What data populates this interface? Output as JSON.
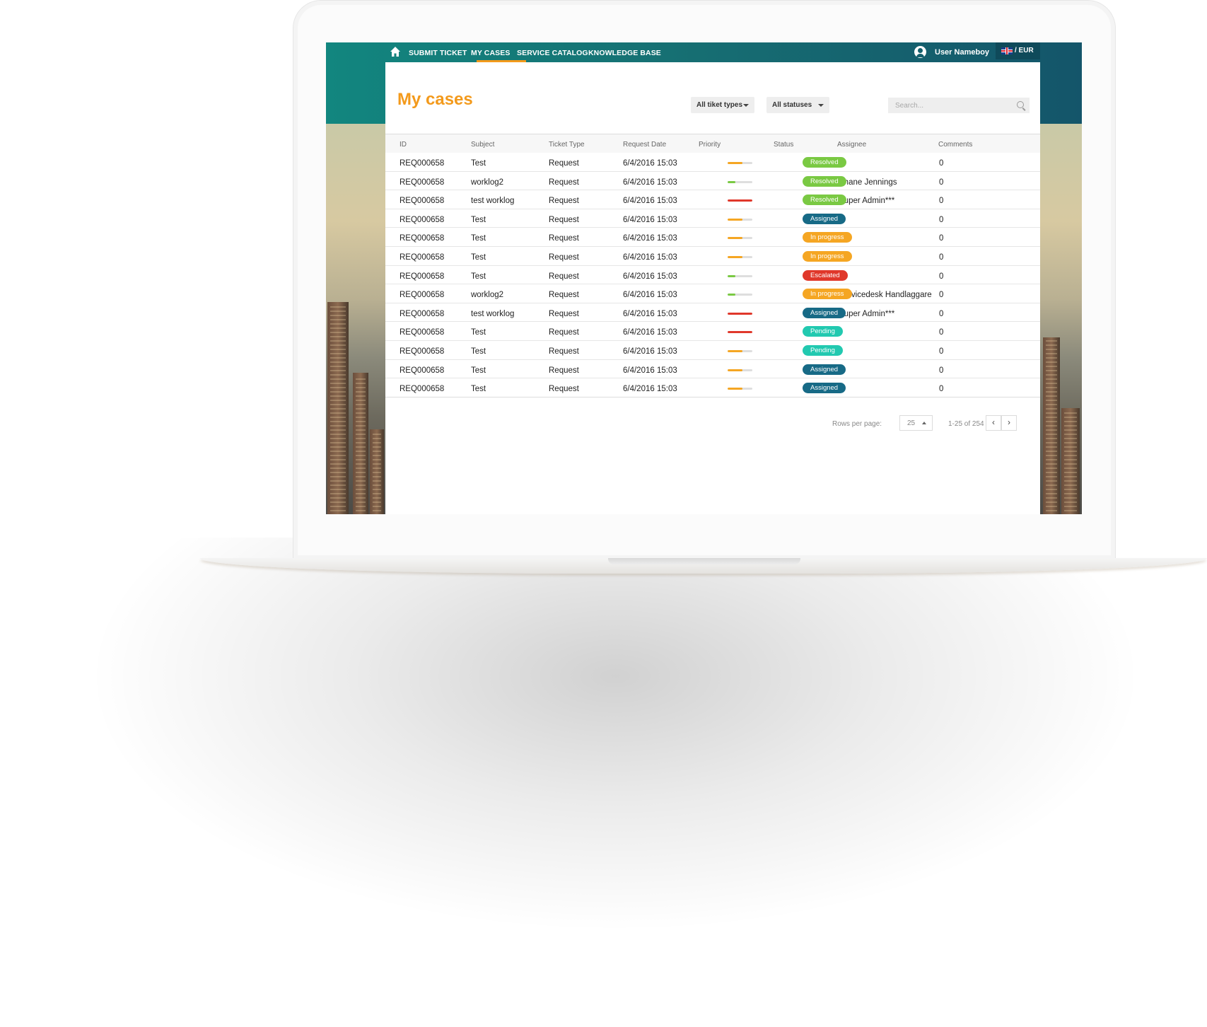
{
  "nav": {
    "items": [
      {
        "label": "SUBMIT TICKET"
      },
      {
        "label": "MY CASES"
      },
      {
        "label": "SERVICE CATALOG"
      },
      {
        "label": "KNOWLEDGE BASE"
      }
    ],
    "user": "User Nameboy",
    "locale": "/ EUR",
    "icons": [
      "home-icon",
      "user-icon",
      "uk-flag-icon"
    ]
  },
  "page": {
    "title": "My cases",
    "filter_type": "All tiket types",
    "filter_status": "All statuses",
    "search_placeholder": "Search..."
  },
  "table": {
    "headers": [
      "ID",
      "Subject",
      "Ticket Type",
      "Request Date",
      "Priority",
      "Status",
      "Assignee",
      "Comments"
    ],
    "rows": [
      {
        "id": "REQ000658",
        "subject": "Test",
        "type": "Request",
        "date": "6/4/2016 15:03",
        "priority": 0.6,
        "priority_color": "#f5a623",
        "status": "Resolved",
        "status_color": "#7ac943",
        "assignee": "",
        "comments": "0"
      },
      {
        "id": "REQ000658",
        "subject": "worklog2",
        "type": "Request",
        "date": "6/4/2016 15:03",
        "priority": 0.3,
        "priority_color": "#7ac943",
        "status": "Resolved",
        "status_color": "#7ac943",
        "assignee": "Shane Jennings",
        "comments": "0"
      },
      {
        "id": "REQ000658",
        "subject": "test worklog",
        "type": "Request",
        "date": "6/4/2016 15:03",
        "priority": 1.0,
        "priority_color": "#e0382b",
        "status": "Resolved",
        "status_color": "#7ac943",
        "assignee": "Super Admin***",
        "comments": "0"
      },
      {
        "id": "REQ000658",
        "subject": "Test",
        "type": "Request",
        "date": "6/4/2016 15:03",
        "priority": 0.6,
        "priority_color": "#f5a623",
        "status": "Assigned",
        "status_color": "#176a86",
        "assignee": "",
        "comments": "0"
      },
      {
        "id": "REQ000658",
        "subject": "Test",
        "type": "Request",
        "date": "6/4/2016 15:03",
        "priority": 0.6,
        "priority_color": "#f5a623",
        "status": "In progress",
        "status_color": "#f5a623",
        "assignee": "",
        "comments": "0"
      },
      {
        "id": "REQ000658",
        "subject": "Test",
        "type": "Request",
        "date": "6/4/2016 15:03",
        "priority": 0.6,
        "priority_color": "#f5a623",
        "status": "In progress",
        "status_color": "#f5a623",
        "assignee": "",
        "comments": "0"
      },
      {
        "id": "REQ000658",
        "subject": "Test",
        "type": "Request",
        "date": "6/4/2016 15:03",
        "priority": 0.3,
        "priority_color": "#7ac943",
        "status": "Escalated",
        "status_color": "#e0382b",
        "assignee": "",
        "comments": "0"
      },
      {
        "id": "REQ000658",
        "subject": "worklog2",
        "type": "Request",
        "date": "6/4/2016 15:03",
        "priority": 0.3,
        "priority_color": "#7ac943",
        "status": "In progress",
        "status_color": "#f5a623",
        "assignee": "Servicedesk Handlaggare",
        "comments": "0"
      },
      {
        "id": "REQ000658",
        "subject": "test worklog",
        "type": "Request",
        "date": "6/4/2016 15:03",
        "priority": 1.0,
        "priority_color": "#e0382b",
        "status": "Assigned",
        "status_color": "#176a86",
        "assignee": "Super Admin***",
        "comments": "0"
      },
      {
        "id": "REQ000658",
        "subject": "Test",
        "type": "Request",
        "date": "6/4/2016 15:03",
        "priority": 1.0,
        "priority_color": "#e0382b",
        "status": "Pending",
        "status_color": "#22c9b0",
        "assignee": "",
        "comments": "0"
      },
      {
        "id": "REQ000658",
        "subject": "Test",
        "type": "Request",
        "date": "6/4/2016 15:03",
        "priority": 0.6,
        "priority_color": "#f5a623",
        "status": "Pending",
        "status_color": "#22c9b0",
        "assignee": "",
        "comments": "0"
      },
      {
        "id": "REQ000658",
        "subject": "Test",
        "type": "Request",
        "date": "6/4/2016 15:03",
        "priority": 0.6,
        "priority_color": "#f5a623",
        "status": "Assigned",
        "status_color": "#176a86",
        "assignee": "",
        "comments": "0"
      },
      {
        "id": "REQ000658",
        "subject": "Test",
        "type": "Request",
        "date": "6/4/2016 15:03",
        "priority": 0.6,
        "priority_color": "#f5a623",
        "status": "Assigned",
        "status_color": "#176a86",
        "assignee": "",
        "comments": "0"
      }
    ]
  },
  "pagination": {
    "rows_per_page_label": "Rows per page:",
    "rows_per_page": "25",
    "range": "1-25 of 254",
    "prev": "‹",
    "next": "›"
  },
  "colors": {
    "accent": "#f39a1c",
    "header_teal": "#167073"
  }
}
